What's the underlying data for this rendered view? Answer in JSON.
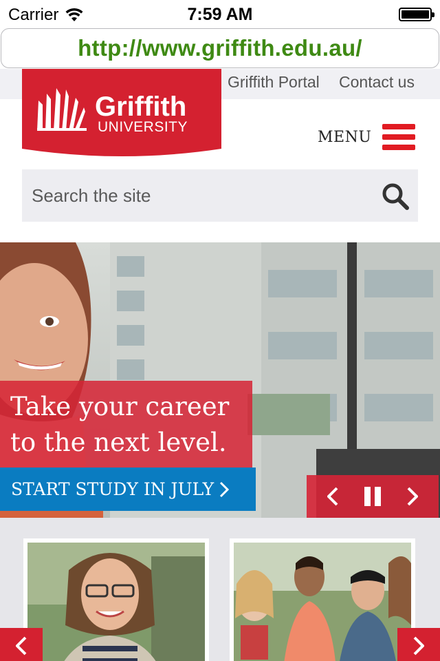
{
  "status_bar": {
    "carrier": "Carrier",
    "time": "7:59 AM"
  },
  "browser": {
    "url": "http://www.griffith.edu.au/"
  },
  "header": {
    "links": [
      "Griffith Portal",
      "Contact us"
    ],
    "logo": {
      "name": "Griffith",
      "subtitle": "UNIVERSITY",
      "brand_color": "#d42130"
    },
    "menu_label": "MENU"
  },
  "search": {
    "placeholder": "Search the site",
    "icon": "search-icon"
  },
  "hero": {
    "headline_line1": "Take your career",
    "headline_line2": "to the next level.",
    "cta": "START STUDY IN JULY",
    "controls": [
      "chevron-left-icon",
      "pause-icon",
      "chevron-right-icon"
    ]
  },
  "cards": {
    "nav": [
      "chevron-left-icon",
      "chevron-right-icon"
    ]
  },
  "colors": {
    "brand_red": "#d42130",
    "cta_blue": "#0a7cc1",
    "url_green": "#3f8a14",
    "menu_red": "#e11b22"
  }
}
